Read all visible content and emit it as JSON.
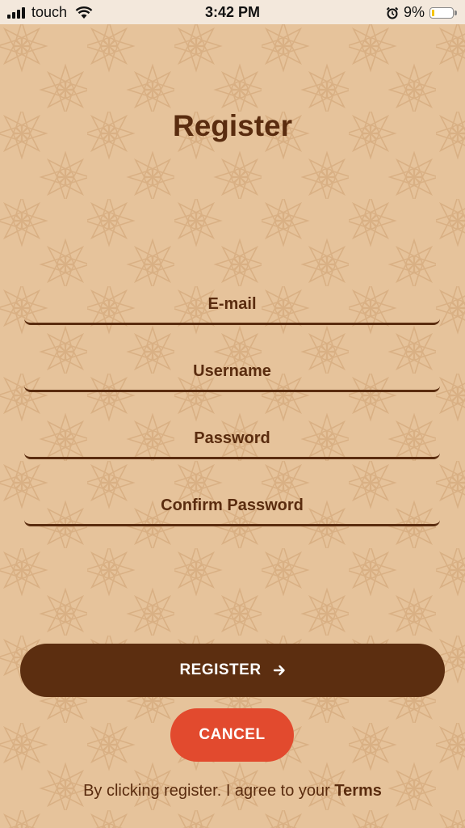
{
  "status_bar": {
    "carrier": "touch",
    "time": "3:42 PM",
    "battery_percent": "9%",
    "icons": [
      "signal-icon",
      "wifi-icon",
      "alarm-icon",
      "battery-icon"
    ]
  },
  "page": {
    "title": "Register"
  },
  "form": {
    "email_placeholder": "E-mail",
    "username_placeholder": "Username",
    "password_placeholder": "Password",
    "confirm_password_placeholder": "Confirm Password"
  },
  "actions": {
    "register_label": "REGISTER",
    "register_icon": "arrow-right-icon",
    "cancel_label": "CANCEL"
  },
  "footer": {
    "terms_prefix": "By clicking register. I agree to your ",
    "terms_link": "Terms"
  },
  "colors": {
    "background": "#e6c39b",
    "primary": "#5c2e10",
    "cancel": "#e24a2e",
    "status_bar": "#f3e8dc"
  }
}
